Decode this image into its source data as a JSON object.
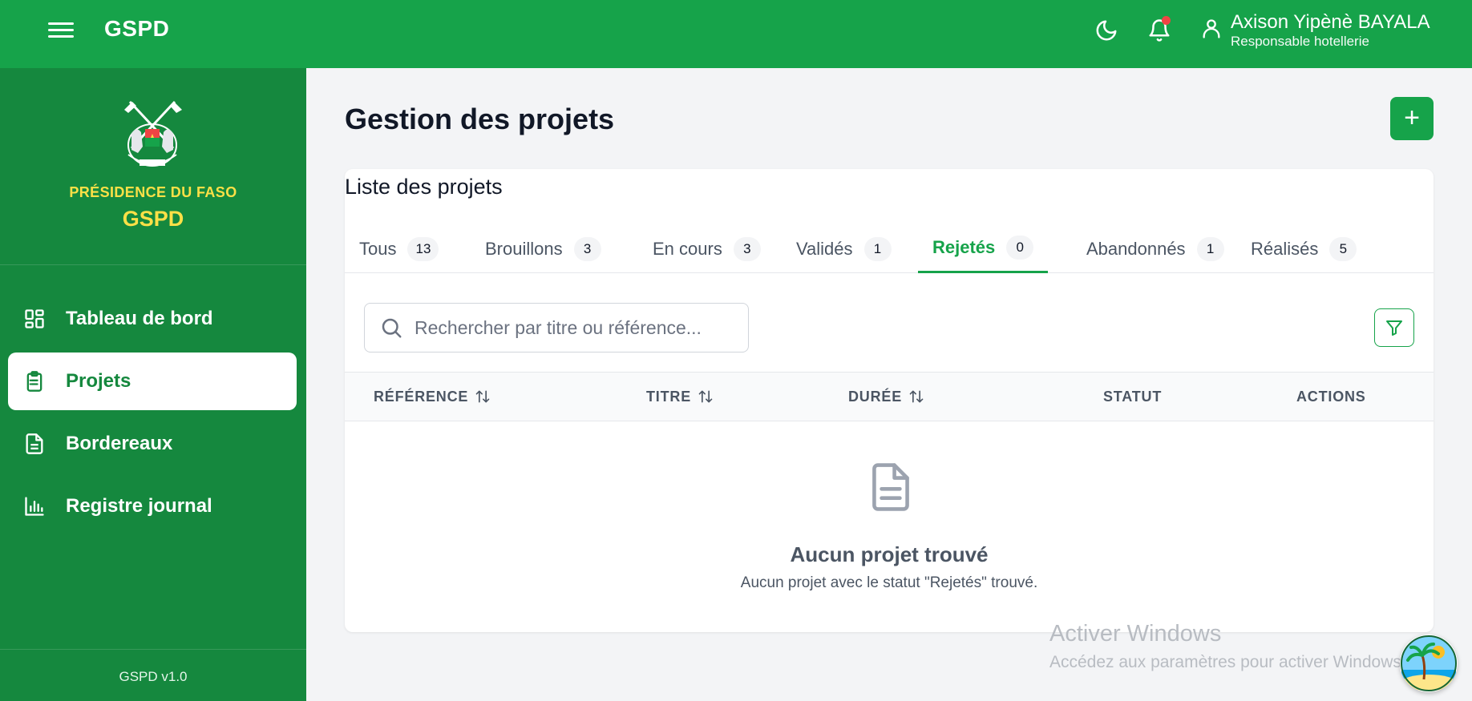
{
  "header": {
    "brand": "GSPD",
    "user_name": "Axison Yipènè BAYALA",
    "user_role": "Responsable hotellerie"
  },
  "sidebar": {
    "org_name": "PRÉSIDENCE DU FASO",
    "app_name": "GSPD",
    "items": [
      {
        "label": "Tableau de bord",
        "icon": "dashboard-grid-icon"
      },
      {
        "label": "Projets",
        "icon": "clipboard-icon",
        "active": true
      },
      {
        "label": "Bordereaux",
        "icon": "document-icon"
      },
      {
        "label": "Registre journal",
        "icon": "bar-chart-icon"
      }
    ],
    "version": "GSPD v1.0"
  },
  "main": {
    "page_title": "Gestion des projets",
    "add_button_label": "+",
    "card_title": "Liste des projets",
    "tabs": [
      {
        "label": "Tous",
        "count": "13"
      },
      {
        "label": "Brouillons",
        "count": "3"
      },
      {
        "label": "En cours",
        "count": "3"
      },
      {
        "label": "Validés",
        "count": "1"
      },
      {
        "label": "Rejetés",
        "count": "0",
        "active": true
      },
      {
        "label": "Abandonnés",
        "count": "1"
      },
      {
        "label": "Réalisés",
        "count": "5"
      }
    ],
    "search": {
      "placeholder": "Rechercher par titre ou référence...",
      "value": ""
    },
    "columns": [
      "RÉFÉRENCE",
      "TITRE",
      "DURÉE",
      "STATUT",
      "ACTIONS"
    ],
    "empty_title": "Aucun projet trouvé",
    "empty_message": "Aucun projet avec le statut \"Rejetés\" trouvé."
  },
  "overlay": {
    "watermark_title": "Activer Windows",
    "watermark_sub": "Accédez aux paramètres pour activer Windows."
  },
  "colors": {
    "primary": "#16a34a",
    "sidebar": "#15883e",
    "accent_yellow": "#fde047",
    "notification": "#ef4444"
  }
}
